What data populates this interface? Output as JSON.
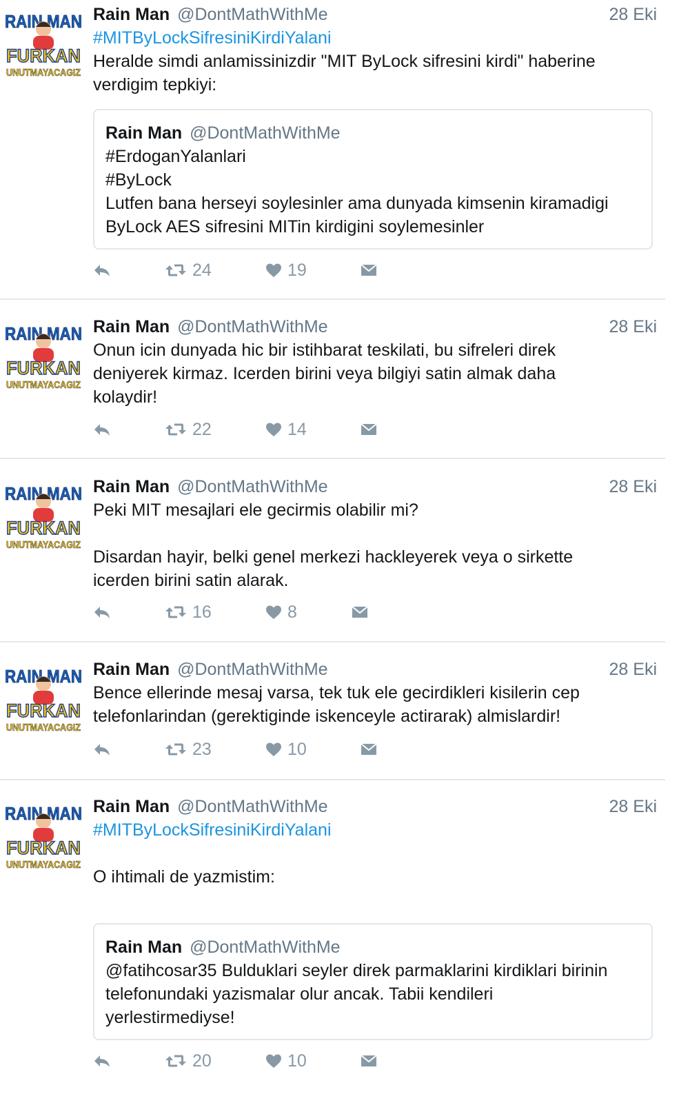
{
  "colors": {
    "hashtag": "#1b95e0",
    "muted": "#657786",
    "icon": "#8899a6",
    "border": "#e1e8ed"
  },
  "icons": {
    "reply": "reply-icon",
    "retweet": "retweet-icon",
    "like": "heart-icon",
    "message": "direct-message-icon"
  },
  "avatar": {
    "top_text": "RAIN MAN",
    "middle_text": "FURKAN",
    "bottom_text": "UNUTMAYACAGIZ"
  },
  "tweets": [
    {
      "name": "Rain Man",
      "handle": "@DontMathWithMe",
      "date": "28 Eki",
      "hashtag": "#MITByLockSifresiniKirdiYalani",
      "lines": [
        "Heralde simdi anlamissinizdir \"MIT ByLock sifresini kirdi\" haberine",
        "verdigim tepkiyi:"
      ],
      "quote": {
        "name": "Rain Man",
        "handle": "@DontMathWithMe",
        "lines": [
          "#ErdoganYalanlari",
          "#ByLock",
          "Lutfen bana herseyi soylesinler ama dunyada kimsenin kiramadigi",
          "ByLock AES sifresini MITin kirdigini soylemesinler"
        ]
      },
      "retweets": "24",
      "likes": "19"
    },
    {
      "name": "Rain Man",
      "handle": "@DontMathWithMe",
      "date": "28 Eki",
      "lines": [
        "Onun icin dunyada hic bir istihbarat teskilati, bu sifreleri direk",
        "deniyerek kirmaz. Icerden birini veya bilgiyi satin almak daha",
        "kolaydir!"
      ],
      "retweets": "22",
      "likes": "14"
    },
    {
      "name": "Rain Man",
      "handle": "@DontMathWithMe",
      "date": "28 Eki",
      "lines": [
        "Peki MIT mesajlari ele gecirmis olabilir mi?"
      ],
      "lines_after": [
        "Disardan hayir, belki genel merkezi hackleyerek veya o sirkette",
        "icerden birini satin alarak."
      ],
      "retweets": "16",
      "likes": "8"
    },
    {
      "name": "Rain Man",
      "handle": "@DontMathWithMe",
      "date": "28 Eki",
      "lines": [
        "Bence ellerinde mesaj varsa, tek tuk ele gecirdikleri kisilerin cep",
        "telefonlarindan (gerektiginde iskenceyle actirarak) almislardir!"
      ],
      "retweets": "23",
      "likes": "10"
    },
    {
      "name": "Rain Man",
      "handle": "@DontMathWithMe",
      "date": "28 Eki",
      "hashtag": "#MITByLockSifresiniKirdiYalani",
      "lines": [
        "O ihtimali de yazmistim:"
      ],
      "quote": {
        "name": "Rain Man",
        "handle": "@DontMathWithMe",
        "lines": [
          "@fatihcosar35 Bulduklari seyler direk parmaklarini kirdiklari birinin",
          "telefonundaki yazismalar olur ancak. Tabii kendileri",
          "yerlestirmediyse!"
        ]
      },
      "retweets": "20",
      "likes": "10"
    }
  ]
}
